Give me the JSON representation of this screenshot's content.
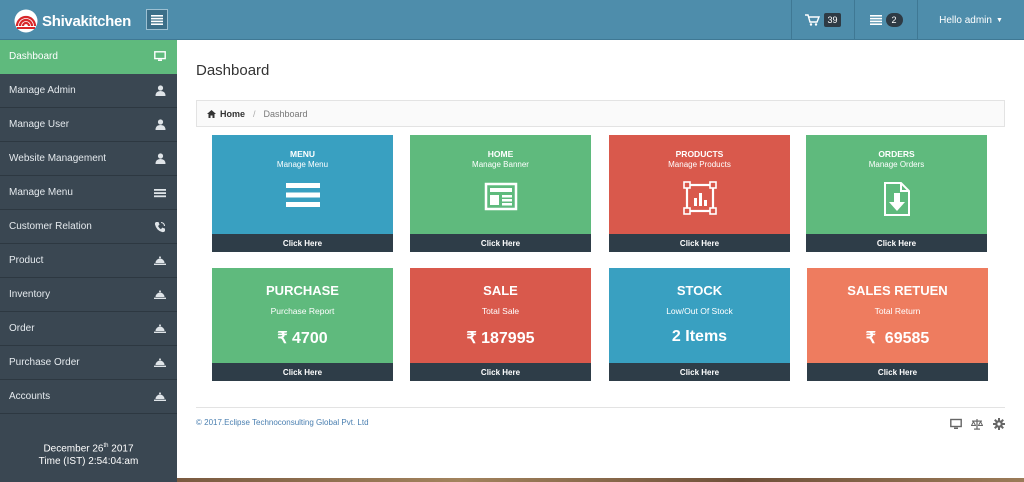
{
  "header": {
    "brand": "Shivakitchen",
    "cart_count": "39",
    "task_count": "2",
    "user_greeting": "Hello admin"
  },
  "sidebar": {
    "items": [
      {
        "label": "Dashboard",
        "icon": "monitor-icon",
        "active": true
      },
      {
        "label": "Manage Admin",
        "icon": "user-icon"
      },
      {
        "label": "Manage User",
        "icon": "user-icon"
      },
      {
        "label": "Website Management",
        "icon": "user-icon"
      },
      {
        "label": "Manage Menu",
        "icon": "list-icon"
      },
      {
        "label": "Customer Relation",
        "icon": "phone-icon"
      },
      {
        "label": "Product",
        "icon": "cloche-icon"
      },
      {
        "label": "Inventory",
        "icon": "cloche-icon"
      },
      {
        "label": "Order",
        "icon": "cloche-icon"
      },
      {
        "label": "Purchase Order",
        "icon": "cloche-icon"
      },
      {
        "label": "Accounts",
        "icon": "cloche-icon"
      }
    ],
    "date_day": "December 26",
    "date_suffix": "th",
    "date_year": "2017",
    "time": "Time (IST) 2:54:04:am"
  },
  "main": {
    "title": "Dashboard",
    "breadcrumb": {
      "home": "Home",
      "separator": "/",
      "current": "Dashboard"
    }
  },
  "cards_top": [
    {
      "title": "MENU",
      "subtitle": "Manage Menu",
      "footer": "Click Here",
      "color": "#39a0c1",
      "icon": "menu-bars-icon"
    },
    {
      "title": "HOME",
      "subtitle": "Manage Banner",
      "footer": "Click Here",
      "color": "#5fba7d",
      "icon": "newspaper-icon"
    },
    {
      "title": "PRODUCTS",
      "subtitle": "Manage Products",
      "footer": "Click Here",
      "color": "#d9594c",
      "icon": "chart-frame-icon"
    },
    {
      "title": "ORDERS",
      "subtitle": "Manage Orders",
      "footer": "Click Here",
      "color": "#5fba7d",
      "icon": "download-doc-icon"
    }
  ],
  "cards_bottom": [
    {
      "title": "PURCHASE",
      "subtitle": "Purchase Report",
      "value": "₹ 4700",
      "footer": "Click Here",
      "color": "#5fba7d"
    },
    {
      "title": "SALE",
      "subtitle": "Total Sale",
      "value": "₹ 187995",
      "footer": "Click Here",
      "color": "#d9594c"
    },
    {
      "title": "STOCK",
      "subtitle": "Low/Out Of Stock",
      "value": "2 Items",
      "footer": "Click Here",
      "color": "#39a0c1"
    },
    {
      "title": "SALES RETUEN",
      "subtitle": "Total Return",
      "value": "₹  69585",
      "footer": "Click Here",
      "color": "#ee7c5f"
    }
  ],
  "footer": {
    "copyright": "© 2017.Eclipse Technoconsulting Global Pvt. Ltd",
    "icons": [
      "monitor-icon",
      "balance-scale-icon",
      "gear-icon"
    ]
  }
}
